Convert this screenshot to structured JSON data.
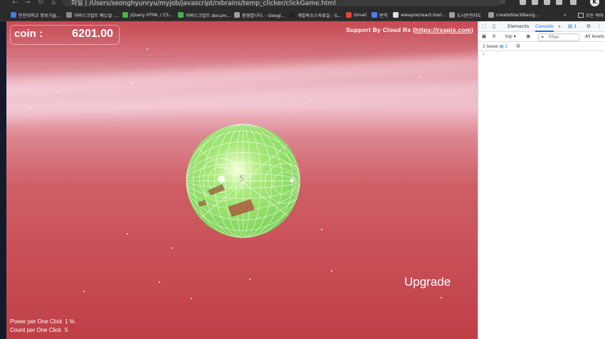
{
  "browser": {
    "url": "/Users/seonghyunryu/myjob/javascript/rxbrains/temp_clicker/clickGame.html",
    "url_prefix": "파일",
    "profile_initial": "K"
  },
  "bookmarks": [
    {
      "label": "인천대학교 정보기술...",
      "color": "#4a7bd8"
    },
    {
      "label": "자바스크립트 배뉴얼 -...",
      "color": "#8a8a8a"
    },
    {
      "label": "jQuery HTML / CS...",
      "color": "#4caf50"
    },
    {
      "label": "자바스크립트 docum...",
      "color": "#4caf50"
    },
    {
      "label": "환영합니다. - Googl...",
      "color": "#9e9e9e"
    },
    {
      "label": "개발외소스자료실 - S...",
      "color": "#222222"
    },
    {
      "label": "Gmail",
      "color": "#ea4335"
    },
    {
      "label": "번역",
      "color": "#4285f4"
    },
    {
      "label": "wwayne/react-tool...",
      "color": "#dddddd"
    },
    {
      "label": "도시안전지도",
      "color": "#9e9e9e"
    },
    {
      "label": "createStackNavig...",
      "color": "#9e9e9e"
    }
  ],
  "bookmarks_more": "»",
  "bookmarks_folder": "모든 북마",
  "game": {
    "coin_label": "coin :",
    "coin_value": "6201.00",
    "support_prefix": "Support By Cloud Rx (",
    "support_link": "https://rxapis.com",
    "support_suffix": ")",
    "upgrade_label": "Upgrade",
    "stats": [
      {
        "label": "Power per One Click",
        "value": "1 %"
      },
      {
        "label": "Count per One Click",
        "value": "5"
      }
    ],
    "sphere_face_label": "5"
  },
  "devtools": {
    "tabs": [
      "Elements",
      "Console"
    ],
    "active_tab": "Console",
    "more_tabs": "»",
    "messages_count": "1",
    "context": "top",
    "filter_placeholder": "Filter",
    "levels": "All levels",
    "issues_label": "1 Issue:",
    "issues_count": "1",
    "prompt": "›"
  }
}
